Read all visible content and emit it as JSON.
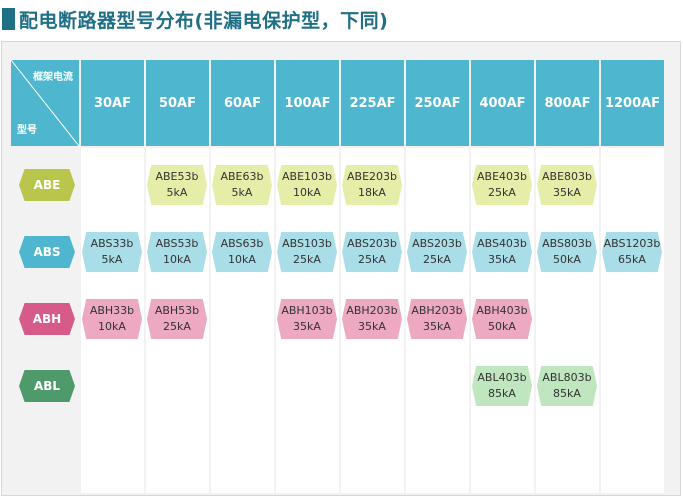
{
  "title": "配电断路器型号分布(非漏电保护型，下同)",
  "corner": {
    "top_label": "框架电流",
    "bottom_label": "型号"
  },
  "columns": [
    "30AF",
    "50AF",
    "60AF",
    "100AF",
    "225AF",
    "250AF",
    "400AF",
    "800AF",
    "1200AF"
  ],
  "colors": {
    "header": "#4fb6cf",
    "title": "#1f6f86",
    "ABE": {
      "tag": "#b9c64b",
      "cell": "#e6eda8"
    },
    "ABS": {
      "tag": "#4fb6cf",
      "cell": "#a9dde8"
    },
    "ABH": {
      "tag": "#d65a8a",
      "cell": "#eda8c2"
    },
    "ABL": {
      "tag": "#4f9a6a",
      "cell": "#bfe6bf"
    }
  },
  "rows": [
    {
      "series": "ABE",
      "cells": [
        null,
        {
          "model": "ABE53b",
          "rating": "5kA"
        },
        {
          "model": "ABE63b",
          "rating": "5kA"
        },
        {
          "model": "ABE103b",
          "rating": "10kA"
        },
        {
          "model": "ABE203b",
          "rating": "18kA"
        },
        null,
        {
          "model": "ABE403b",
          "rating": "25kA"
        },
        {
          "model": "ABE803b",
          "rating": "35kA"
        },
        null
      ]
    },
    {
      "series": "ABS",
      "cells": [
        {
          "model": "ABS33b",
          "rating": "5kA"
        },
        {
          "model": "ABS53b",
          "rating": "10kA"
        },
        {
          "model": "ABS63b",
          "rating": "10kA"
        },
        {
          "model": "ABS103b",
          "rating": "25kA"
        },
        {
          "model": "ABS203b",
          "rating": "25kA"
        },
        {
          "model": "ABS203b",
          "rating": "25kA"
        },
        {
          "model": "ABS403b",
          "rating": "35kA"
        },
        {
          "model": "ABS803b",
          "rating": "50kA"
        },
        {
          "model": "ABS1203b",
          "rating": "65kA"
        }
      ]
    },
    {
      "series": "ABH",
      "cells": [
        {
          "model": "ABH33b",
          "rating": "10kA"
        },
        {
          "model": "ABH53b",
          "rating": "25kA"
        },
        null,
        {
          "model": "ABH103b",
          "rating": "35kA"
        },
        {
          "model": "ABH203b",
          "rating": "35kA"
        },
        {
          "model": "ABH203b",
          "rating": "35kA"
        },
        {
          "model": "ABH403b",
          "rating": "50kA"
        },
        null,
        null
      ]
    },
    {
      "series": "ABL",
      "cells": [
        null,
        null,
        null,
        null,
        null,
        null,
        {
          "model": "ABL403b",
          "rating": "85kA"
        },
        {
          "model": "ABL803b",
          "rating": "85kA"
        },
        null
      ]
    }
  ]
}
